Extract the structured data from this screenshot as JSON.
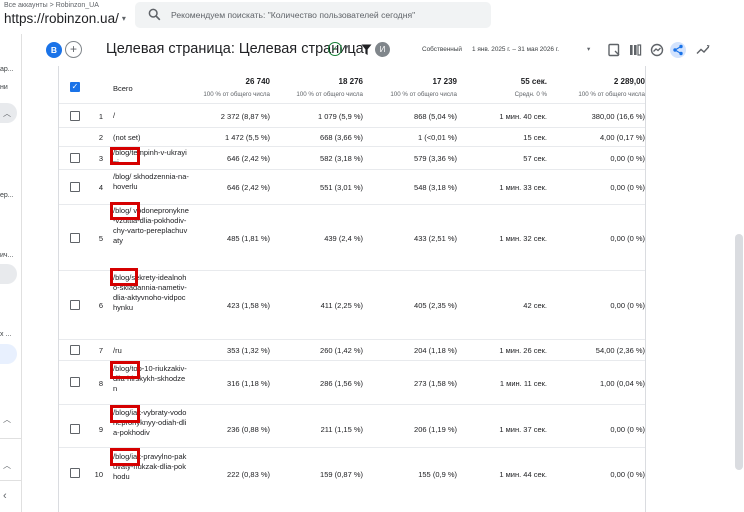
{
  "header": {
    "breadcrumb_all": "Все аккаунты",
    "breadcrumb_sep": ">",
    "breadcrumb_account": "Robinzon_UA",
    "property": "https://robinzon.ua/",
    "property_caret": "▾",
    "search_placeholder": "Рекомендуем поискать: \"Количество пользователей сегодня\""
  },
  "sidebar": {
    "texts": [
      "ар...",
      "ни",
      "ер...",
      "ич...",
      "х ..."
    ]
  },
  "toolbar": {
    "compare_badge": "B",
    "add_comparison": "+",
    "title": "Целевая страница: Целевая страница",
    "status_check": "✓",
    "status_caret": "▾",
    "avatar_letter": "И",
    "data_type": "Собственный",
    "date_range": "1 янв. 2025 г. – 31 мая 2026 г.",
    "date_caret": "▾"
  },
  "table": {
    "header": {
      "label": "Всего",
      "totals": [
        {
          "value": "26 740",
          "sub": "100 % от общего числа"
        },
        {
          "value": "18 276",
          "sub": "100 % от общего числа"
        },
        {
          "value": "17 239",
          "sub": "100 % от общего числа"
        },
        {
          "value": "55 сек.",
          "sub": "Средн. 0 %"
        },
        {
          "value": "2 289,00",
          "sub": "100 % от общего числа"
        }
      ]
    },
    "rows": [
      {
        "idx": "1",
        "page": "/",
        "c1": "2 372 (8,87 %)",
        "c2": "1 079 (5,9 %)",
        "c3": "868 (5,04 %)",
        "c4": "1 мин. 40 сек.",
        "c5": "380,00 (16,6 %)"
      },
      {
        "idx": "2",
        "page": "(not set)",
        "c1": "1 472 (5,5 %)",
        "c2": "668 (3,66 %)",
        "c3": "1 (<0,01 %)",
        "c4": "15 сек.",
        "c5": "4,00 (0,17 %)"
      },
      {
        "idx": "3",
        "page": "/blog/tempinh-v-ukrayini",
        "c1": "646 (2,42 %)",
        "c2": "582 (3,18 %)",
        "c3": "579 (3,36 %)",
        "c4": "57 сек.",
        "c5": "0,00 (0 %)"
      },
      {
        "idx": "4",
        "page": "/blog/ skhodzennia-na-hoverlu",
        "c1": "646 (2,42 %)",
        "c2": "551 (3,01 %)",
        "c3": "548 (3,18 %)",
        "c4": "1 мин. 33 сек.",
        "c5": "0,00 (0 %)"
      },
      {
        "idx": "5",
        "page": "/blog/ vodonepronykne-vzuttia-dlia-pokhodiv-chy-varto-pereplachuvaty",
        "c1": "485 (1,81 %)",
        "c2": "439 (2,4 %)",
        "c3": "433 (2,51 %)",
        "c4": "1 мин. 32 сек.",
        "c5": "0,00 (0 %)"
      },
      {
        "idx": "6",
        "page": "/blog/sekrety-idealnoho-skladannia-nametiv-dlia-aktyvnoho-vidpochynku",
        "c1": "423 (1,58 %)",
        "c2": "411 (2,25 %)",
        "c3": "405 (2,35 %)",
        "c4": "42 сек.",
        "c5": "0,00 (0 %)"
      },
      {
        "idx": "7",
        "page": "/ru",
        "c1": "353 (1,32 %)",
        "c2": "260 (1,42 %)",
        "c3": "204 (1,18 %)",
        "c4": "1 мин. 26 сек.",
        "c5": "54,00 (2,36 %)"
      },
      {
        "idx": "8",
        "page": "/blog/top-10-riukzakiv-dlia-hirskykh-skhodzen",
        "c1": "316 (1,18 %)",
        "c2": "286 (1,56 %)",
        "c3": "273 (1,58 %)",
        "c4": "1 мин. 11 сек.",
        "c5": "1,00 (0,04 %)"
      },
      {
        "idx": "9",
        "page": "/blog/iak-vybraty-vodonepronyknyy-odiah-dlia-pokhodiv",
        "c1": "236 (0,88 %)",
        "c2": "211 (1,15 %)",
        "c3": "206 (1,19 %)",
        "c4": "1 мин. 37 сек.",
        "c5": "0,00 (0 %)"
      },
      {
        "idx": "10",
        "page": "/blog/iak-pravylno-pakuvaty-riukzak-dlia-pokhodu",
        "c1": "222 (0,83 %)",
        "c2": "159 (0,87 %)",
        "c3": "155 (0,9 %)",
        "c4": "1 мин. 44 сек.",
        "c5": "0,00 (0 %)"
      }
    ]
  },
  "colors": {
    "accent": "#1a73e8",
    "highlight": "#d50000",
    "ok": "#188038"
  }
}
